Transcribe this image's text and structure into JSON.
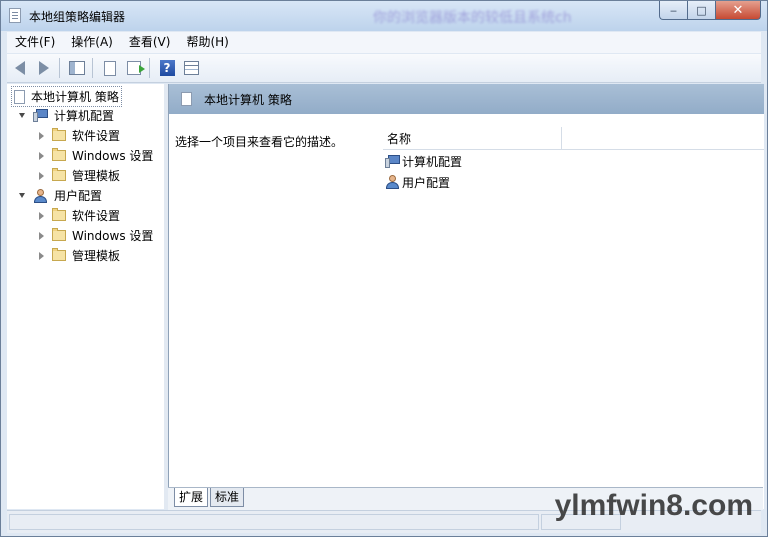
{
  "window": {
    "title": "本地组策略编辑器",
    "title_blurred": "你的浏览器版本的较低且系统ch",
    "controls": {
      "minimize": "‒",
      "maximize": "□",
      "close": "✕"
    }
  },
  "menu": {
    "items": [
      {
        "label": "文件(F)"
      },
      {
        "label": "操作(A)"
      },
      {
        "label": "查看(V)"
      },
      {
        "label": "帮助(H)"
      }
    ]
  },
  "tree": {
    "root": {
      "label": "本地计算机 策略"
    },
    "computer": {
      "label": "计算机配置",
      "children": [
        {
          "label": "软件设置"
        },
        {
          "label": "Windows 设置"
        },
        {
          "label": "管理模板"
        }
      ]
    },
    "user": {
      "label": "用户配置",
      "children": [
        {
          "label": "软件设置"
        },
        {
          "label": "Windows 设置"
        },
        {
          "label": "管理模板"
        }
      ]
    }
  },
  "right": {
    "header": "本地计算机 策略",
    "description": "选择一个项目来查看它的描述。",
    "list": {
      "column_name": "名称",
      "rows": [
        {
          "label": "计算机配置"
        },
        {
          "label": "用户配置"
        }
      ]
    }
  },
  "tabs": [
    {
      "label": "扩展"
    },
    {
      "label": "标准"
    }
  ],
  "watermark": "ylmfwin8.com"
}
